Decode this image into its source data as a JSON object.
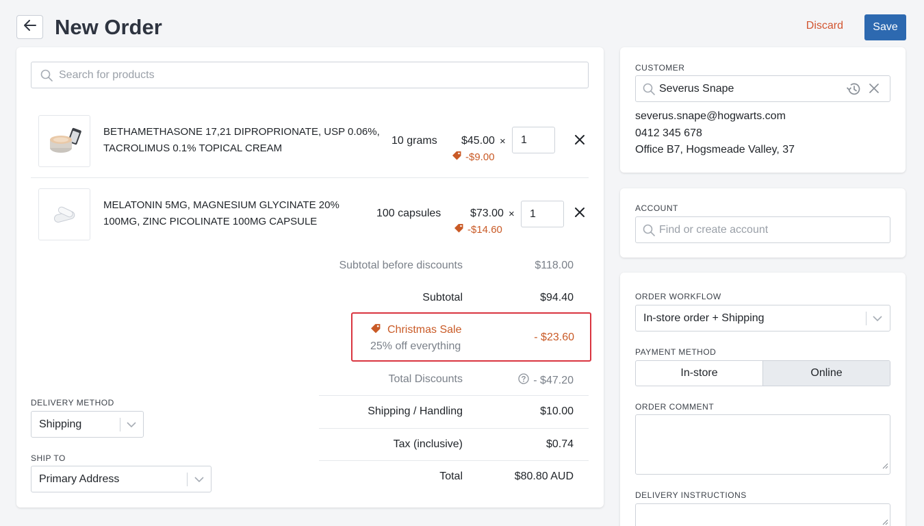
{
  "header": {
    "title": "New Order",
    "discard_label": "Discard",
    "save_label": "Save",
    "back_icon": "arrow-left-icon"
  },
  "product_search": {
    "placeholder": "Search for products"
  },
  "line_items": [
    {
      "name_line1": "BETHAMETHASONE 17,21 DIPROPRIONATE, USP 0.06%,",
      "name_line2": "TACROLIMUS 0.1% TOPICAL CREAM",
      "size": "10 grams",
      "price": "$45.00",
      "discount": "-$9.00",
      "qty": "1",
      "times": "×"
    },
    {
      "name_line1": "MELATONIN 5MG, MAGNESIUM GLYCINATE 20%",
      "name_line2": "100MG, ZINC PICOLINATE 100MG CAPSULE",
      "size": "100 capsules",
      "price": "$73.00",
      "discount": "-$14.60",
      "qty": "1",
      "times": "×"
    }
  ],
  "summary": {
    "subtotal_before_label": "Subtotal before discounts",
    "subtotal_before_value": "$118.00",
    "subtotal_label": "Subtotal",
    "subtotal_value": "$94.40",
    "sale_name": "Christmas Sale",
    "sale_desc": "25% off everything",
    "sale_value": "- $23.60",
    "total_discounts_label": "Total Discounts",
    "total_discounts_value": "- $47.20",
    "shipping_label": "Shipping / Handling",
    "shipping_value": "$10.00",
    "tax_label": "Tax (inclusive)",
    "tax_value": "$0.74",
    "total_label": "Total",
    "total_value": "$80.80 AUD"
  },
  "delivery": {
    "method_label": "DELIVERY METHOD",
    "method_value": "Shipping",
    "ship_to_label": "SHIP TO",
    "ship_to_value": "Primary Address"
  },
  "customer": {
    "label": "CUSTOMER",
    "name": "Severus Snape",
    "email": "severus.snape@hogwarts.com",
    "phone": "0412 345 678",
    "address": "Office B7, Hogsmeade Valley, 37"
  },
  "account": {
    "label": "ACCOUNT",
    "placeholder": "Find or create account"
  },
  "workflow": {
    "label": "ORDER WORKFLOW",
    "value": "In-store order + Shipping",
    "payment_label": "PAYMENT METHOD",
    "payment_options": [
      "In-store",
      "Online"
    ],
    "payment_selected": "Online",
    "comment_label": "ORDER COMMENT",
    "instructions_label": "DELIVERY INSTRUCTIONS"
  },
  "colors": {
    "brand": "#2d69b0",
    "discount": "#c95a26",
    "highlight_border": "#d9343f"
  }
}
